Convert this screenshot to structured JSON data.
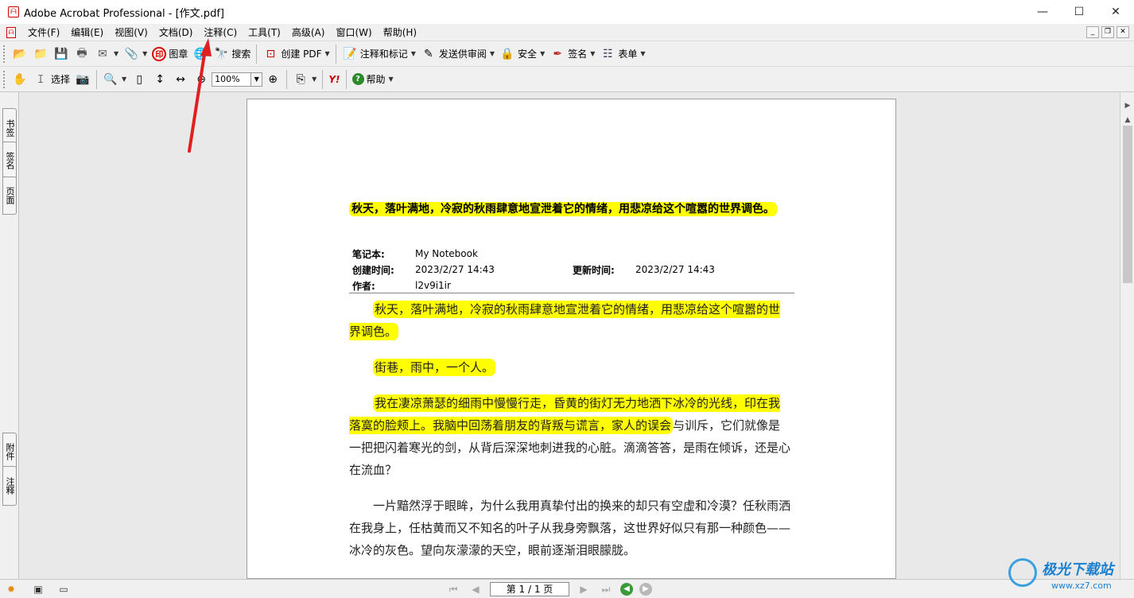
{
  "window": {
    "title": "Adobe Acrobat Professional - [作文.pdf]",
    "controls": {
      "minimize": "—",
      "maximize": "☐",
      "close": "✕"
    }
  },
  "menubar": {
    "items": [
      "文件(F)",
      "编辑(E)",
      "视图(V)",
      "文档(D)",
      "注释(C)",
      "工具(T)",
      "高级(A)",
      "窗口(W)",
      "帮助(H)"
    ]
  },
  "toolbar1": {
    "stamp_label": "图章",
    "search_label": "搜索",
    "create_pdf_label": "创建 PDF",
    "comment_markup_label": "注释和标记",
    "send_review_label": "发送供审阅",
    "security_label": "安全",
    "sign_label": "签名",
    "forms_label": "表单"
  },
  "toolbar2": {
    "select_label": "选择",
    "zoom_value": "100%",
    "help_label": "帮助",
    "yahoo_label": "Y!"
  },
  "left_tabs": {
    "bookmarks": "书签",
    "signatures": "签名",
    "pages": "页面",
    "attachments": "附件",
    "comments": "注释"
  },
  "document": {
    "title": "秋天，落叶满地，冷寂的秋雨肆意地宣泄着它的情绪，用悲凉给这个喧嚣的世界调色。",
    "meta": {
      "notebook_label": "笔记本:",
      "notebook_value": "My Notebook",
      "created_label": "创建时间:",
      "created_value": "2023/2/27 14:43",
      "updated_label": "更新时间:",
      "updated_value": "2023/2/27 14:43",
      "author_label": "作者:",
      "author_value": "l2v9i1ir"
    },
    "para1": "秋天，落叶满地，冷寂的秋雨肆意地宣泄着它的情绪，用悲凉给这个喧嚣的世界调色。",
    "para2": "街巷，雨中，一个人。",
    "para3_highlighted": "我在凄凉萧瑟的细雨中慢慢行走，昏黄的街灯无力地洒下冰冷的光线，印在我落寞的脸颊上。我脑中回荡着朋友的背叛与谎言，家人的误会",
    "para3_plain": "与训斥，它们就像是一把把闪着寒光的剑，从背后深深地刺进我的心脏。滴滴答答，是雨在倾诉，还是心在流血？",
    "para4": "一片黯然浮于眼眸，为什么我用真挚付出的换来的却只有空虚和冷漠？任秋雨洒在我身上，任枯黄而又不知名的叶子从我身旁飘落，这世界好似只有那一种颜色——冰冷的灰色。望向灰濛濛的天空，眼前逐渐泪眼朦胧。"
  },
  "statusbar": {
    "page_indicator": "第 1 / 1 页"
  },
  "watermark": {
    "brand": "极光下载站",
    "url": "www.xz7.com"
  },
  "colors": {
    "highlight": "#ffff00",
    "annotation_arrow": "#e02020"
  }
}
